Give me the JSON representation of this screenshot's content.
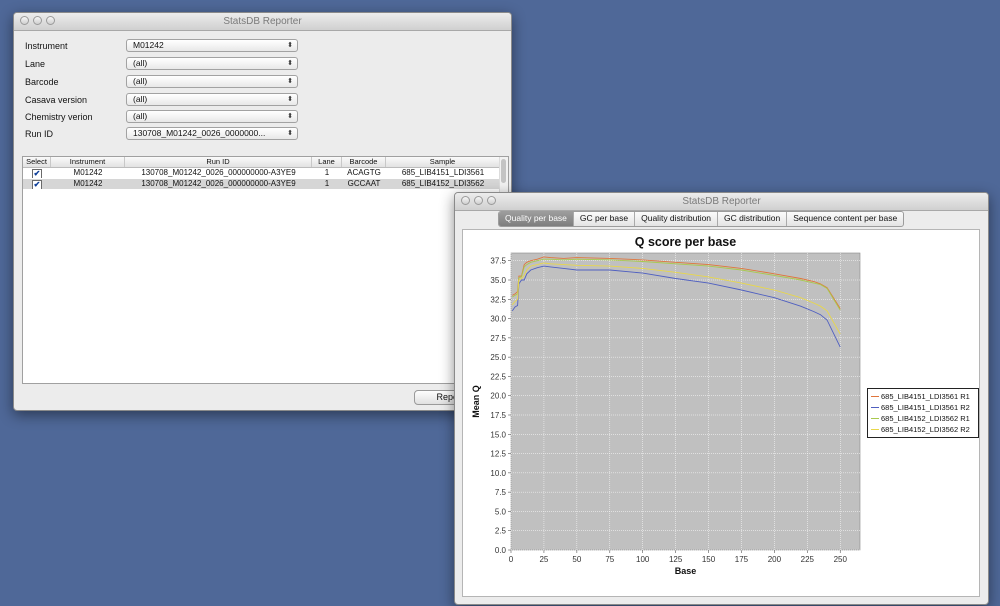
{
  "main_window": {
    "title": "StatsDB Reporter",
    "fields": [
      {
        "label": "Instrument",
        "value": "M01242"
      },
      {
        "label": "Lane",
        "value": "(all)"
      },
      {
        "label": "Barcode",
        "value": "(all)"
      },
      {
        "label": "Casava version",
        "value": "(all)"
      },
      {
        "label": "Chemistry verion",
        "value": "(all)"
      },
      {
        "label": "Run ID",
        "value": "130708_M01242_0026_0000000..."
      }
    ],
    "table": {
      "headers": [
        "Select",
        "Instrument",
        "Run ID",
        "Lane",
        "Barcode",
        "Sample"
      ],
      "rows": [
        {
          "checked": "✔",
          "instrument": "M01242",
          "run_id": "130708_M01242_0026_000000000-A3YE9",
          "lane": "1",
          "barcode": "ACAGTG",
          "sample": "685_LIB4151_LDI3561"
        },
        {
          "checked": "✔",
          "instrument": "M01242",
          "run_id": "130708_M01242_0026_000000000-A3YE9",
          "lane": "1",
          "barcode": "GCCAAT",
          "sample": "685_LIB4152_LDI3562"
        }
      ]
    },
    "report_button": "Report"
  },
  "reporter_window": {
    "title": "StatsDB Reporter",
    "tabs": [
      "Quality per base",
      "GC per base",
      "Quality distribution",
      "GC distribution",
      "Sequence content per base"
    ],
    "active_tab": 0
  },
  "chart_data": {
    "type": "line",
    "title": "Q score per base",
    "xlabel": "Base",
    "ylabel": "Mean Q",
    "xlim": [
      0,
      265
    ],
    "ylim": [
      0,
      38.5
    ],
    "x_ticks": [
      0,
      25,
      50,
      75,
      100,
      125,
      150,
      175,
      200,
      225,
      250
    ],
    "y_ticks": [
      0.0,
      2.5,
      5.0,
      7.5,
      10.0,
      12.5,
      15.0,
      17.5,
      20.0,
      22.5,
      25.0,
      27.5,
      30.0,
      32.5,
      35.0,
      37.5
    ],
    "grid": true,
    "legend_position": "right",
    "series": [
      {
        "name": "685_LIB4151_LDI3561 R1",
        "color": "#e0753c",
        "x": [
          1,
          3,
          5,
          6,
          8,
          10,
          12,
          15,
          20,
          25,
          30,
          40,
          50,
          75,
          100,
          125,
          150,
          175,
          200,
          220,
          230,
          235,
          240,
          250
        ],
        "y": [
          33,
          33.2,
          33.5,
          35.5,
          35.5,
          37,
          37.3,
          37.5,
          37.7,
          38,
          37.9,
          37.8,
          37.9,
          37.8,
          37.6,
          37.3,
          37,
          36.5,
          35.8,
          35.2,
          34.8,
          34.5,
          34,
          31.3
        ]
      },
      {
        "name": "685_LIB4151_LDI3561 R2",
        "color": "#4f5fc0",
        "x": [
          1,
          3,
          5,
          6,
          8,
          10,
          12,
          15,
          20,
          25,
          30,
          40,
          50,
          75,
          100,
          125,
          150,
          175,
          200,
          220,
          230,
          235,
          240,
          250
        ],
        "y": [
          31,
          31.5,
          31.7,
          34.5,
          35,
          35,
          35.8,
          36.3,
          36.6,
          36.8,
          36.7,
          36.5,
          36.3,
          36.3,
          35.9,
          35.2,
          34.6,
          33.7,
          32.7,
          31.6,
          30.9,
          30.5,
          29.8,
          26.3
        ]
      },
      {
        "name": "685_LIB4152_LDI3562 R1",
        "color": "#a9c94e",
        "x": [
          1,
          3,
          5,
          6,
          8,
          10,
          12,
          15,
          20,
          25,
          30,
          40,
          50,
          75,
          100,
          125,
          150,
          175,
          200,
          220,
          230,
          235,
          240,
          250
        ],
        "y": [
          32.8,
          33,
          33.2,
          35.3,
          35.4,
          36.7,
          37,
          37.3,
          37.5,
          37.7,
          37.7,
          37.6,
          37.7,
          37.6,
          37.4,
          37.1,
          36.8,
          36.3,
          35.6,
          35,
          34.6,
          34.4,
          33.9,
          31.1
        ]
      },
      {
        "name": "685_LIB4152_LDI3562 R2",
        "color": "#e8d74a",
        "x": [
          1,
          3,
          5,
          6,
          8,
          10,
          12,
          15,
          20,
          25,
          30,
          40,
          50,
          75,
          100,
          125,
          150,
          175,
          200,
          220,
          230,
          235,
          240,
          250
        ],
        "y": [
          31.8,
          32.2,
          32.5,
          35,
          35.2,
          35.6,
          36.3,
          36.8,
          37,
          37.2,
          37.1,
          37,
          36.9,
          36.8,
          36.5,
          36,
          35.4,
          34.6,
          33.7,
          32.7,
          32,
          31.6,
          31,
          28
        ]
      }
    ]
  }
}
